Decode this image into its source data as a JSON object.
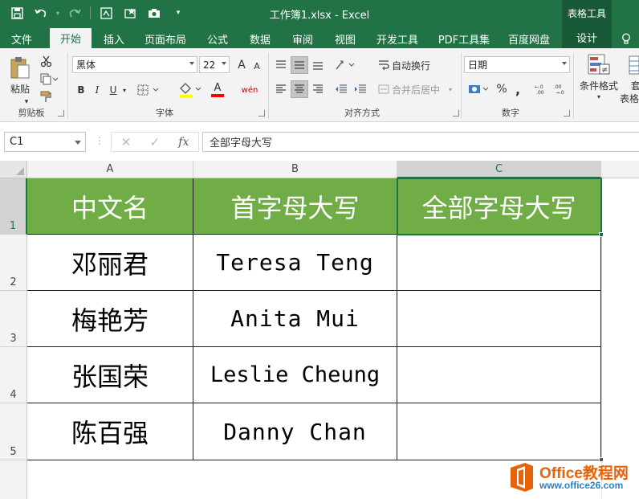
{
  "title_bar": {
    "document_title": "工作簿1.xlsx - Excel",
    "context_tools": "表格工具",
    "accent": "#217346",
    "quick_access": [
      "save-icon",
      "undo-icon",
      "redo-icon",
      "format-painter-icon",
      "new-icon",
      "camera-icon",
      "customize-icon"
    ]
  },
  "tabs": [
    {
      "label": "文件",
      "active": false
    },
    {
      "label": "开始",
      "active": true
    },
    {
      "label": "插入",
      "active": false
    },
    {
      "label": "页面布局",
      "active": false
    },
    {
      "label": "公式",
      "active": false
    },
    {
      "label": "数据",
      "active": false
    },
    {
      "label": "审阅",
      "active": false
    },
    {
      "label": "视图",
      "active": false
    },
    {
      "label": "开发工具",
      "active": false
    },
    {
      "label": "PDF工具集",
      "active": false
    },
    {
      "label": "百度网盘",
      "active": false
    },
    {
      "label": "设计",
      "active": false
    }
  ],
  "ribbon": {
    "clipboard": {
      "label": "剪贴板",
      "paste": "粘贴"
    },
    "font": {
      "label": "字体",
      "name": "黑体",
      "size": "22",
      "bold": "B",
      "italic": "I",
      "underline": "U",
      "phonetic": "wén",
      "grow": "A",
      "shrink": "A",
      "font_color": "A"
    },
    "alignment": {
      "label": "对齐方式",
      "wrap": "自动换行",
      "merge": "合并后居中"
    },
    "number": {
      "label": "数字",
      "format": "日期",
      "percent": "%",
      "comma": ","
    },
    "styles": {
      "conditional": "条件格式",
      "table_partial": "套",
      "table_partial2": "表格"
    }
  },
  "formula_bar": {
    "name_box": "C1",
    "fx": "fx",
    "content": "全部字母大写"
  },
  "sheet": {
    "columns": [
      "A",
      "B",
      "C"
    ],
    "selected_column": "C",
    "rows": [
      "1",
      "2",
      "3",
      "4",
      "5"
    ],
    "selected_row": "1",
    "header_fill": "#70ad47",
    "header": [
      "中文名",
      "首字母大写",
      "全部字母大写"
    ],
    "data": [
      [
        "邓丽君",
        "Teresa Teng",
        ""
      ],
      [
        "梅艳芳",
        "Anita Mui",
        ""
      ],
      [
        "张国荣",
        "Leslie Cheung",
        ""
      ],
      [
        "陈百强",
        "Danny Chan",
        ""
      ]
    ]
  },
  "watermark": {
    "brand": "Office教程网",
    "url": "www.office26.com"
  }
}
